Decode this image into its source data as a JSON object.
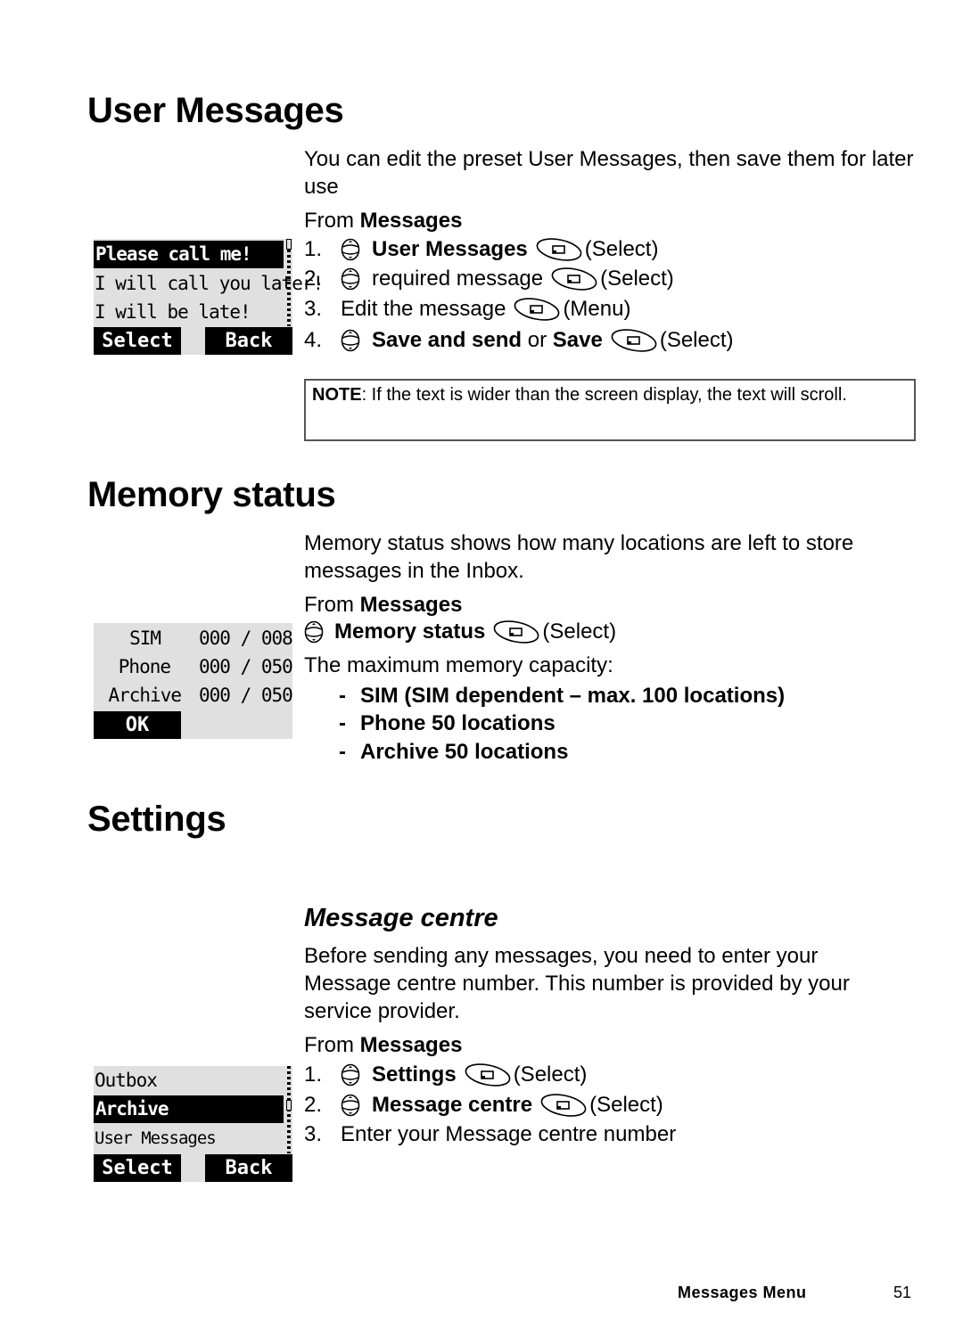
{
  "sections": {
    "user_messages": {
      "title": "User Messages",
      "intro": "You can edit the preset User Messages, then save them for later use",
      "from_prefix": "From ",
      "from_menu": "Messages",
      "steps": [
        {
          "num": "1.",
          "nav": true,
          "bold": "User Messages",
          "plain": "",
          "bold2": "",
          "softkey": true,
          "action": "(Select)"
        },
        {
          "num": "2.",
          "nav": true,
          "bold": "",
          "plain": "required message",
          "bold2": "",
          "softkey": true,
          "action": "(Select)"
        },
        {
          "num": "3.",
          "nav": false,
          "bold": "",
          "plain": "Edit the message",
          "bold2": "",
          "softkey": true,
          "action": "(Menu)"
        },
        {
          "num": "4.",
          "nav": true,
          "bold": "Save and send",
          "plain": " or ",
          "bold2": "Save",
          "softkey": true,
          "action": "(Select)"
        }
      ],
      "note_label": "NOTE",
      "note_text": ": If the text is wider than the screen display, the text will scroll.",
      "screen": {
        "rows": [
          "Please call me!",
          "I will call you later!",
          "I will be late!"
        ],
        "selected_index": 0,
        "left_key": "Select",
        "right_key": "Back"
      }
    },
    "memory_status": {
      "title": "Memory status",
      "intro": "Memory status shows how many locations are left to store messages in the Inbox.",
      "from_prefix": "From ",
      "from_menu": "Messages",
      "step": {
        "bold": "Memory status",
        "action": "(Select)"
      },
      "capacity_label": "The maximum memory capacity:",
      "capacity_items": [
        "SIM (SIM dependent – max. 100 locations)",
        "Phone 50 locations",
        "Archive 50 locations"
      ],
      "screen": {
        "rows": [
          {
            "label": "SIM",
            "value": "000 / 008"
          },
          {
            "label": "Phone",
            "value": "000 / 050"
          },
          {
            "label": "Archive",
            "value": "000 / 050"
          }
        ],
        "left_key": "OK"
      }
    },
    "settings": {
      "title": "Settings",
      "subtitle": "Message centre",
      "intro": "Before sending any messages, you need to enter your Message centre number. This number is provided by your service provider.",
      "from_prefix": "From ",
      "from_menu": "Messages",
      "steps": [
        {
          "num": "1.",
          "nav": true,
          "bold": "Settings",
          "softkey": true,
          "action": "(Select)"
        },
        {
          "num": "2.",
          "nav": true,
          "bold": "Message centre",
          "softkey": true,
          "action": "(Select)"
        },
        {
          "num": "3.",
          "nav": false,
          "bold": "",
          "plain": "Enter your Message centre number",
          "softkey": false,
          "action": ""
        }
      ],
      "screen": {
        "rows": [
          "Outbox",
          "Archive",
          "User Messages"
        ],
        "selected_index": 1,
        "left_key": "Select",
        "right_key": "Back"
      }
    }
  },
  "icons": {
    "nav": "scroll-key-icon",
    "softkey": "softkey-icon"
  },
  "footer": {
    "chapter": "Messages Menu",
    "page": "51"
  }
}
